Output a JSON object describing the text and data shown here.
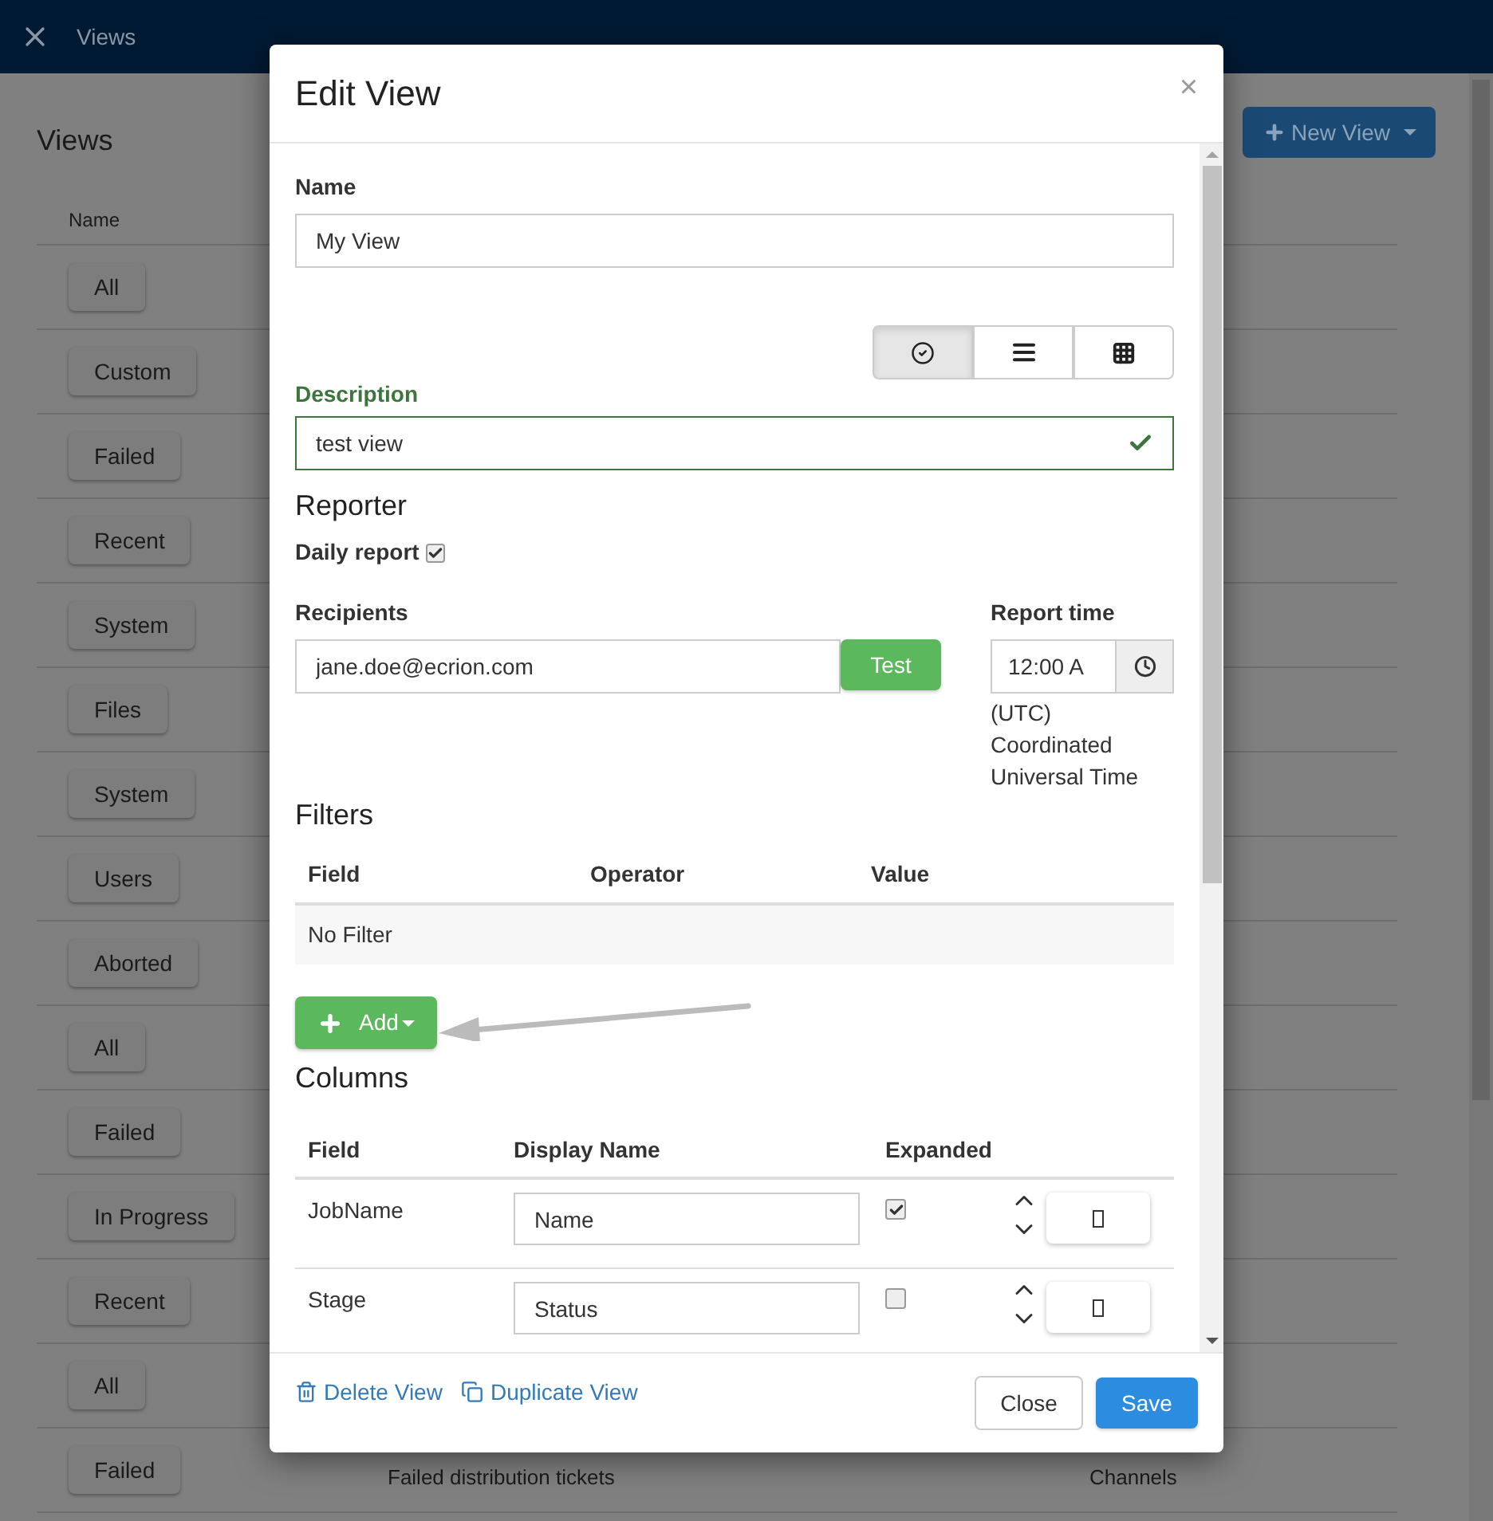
{
  "app_bar": {
    "title": "Views"
  },
  "page": {
    "title": "Views",
    "new_view_button": "New View",
    "name_column": "Name",
    "rows": [
      {
        "name": "All"
      },
      {
        "name": "Custom"
      },
      {
        "name": "Failed"
      },
      {
        "name": "Recent"
      },
      {
        "name": "System"
      },
      {
        "name": "Files"
      },
      {
        "name": "System"
      },
      {
        "name": "Users"
      },
      {
        "name": "Aborted"
      },
      {
        "name": "All"
      },
      {
        "name": "Failed"
      },
      {
        "name": "In Progress"
      },
      {
        "name": "Recent"
      },
      {
        "name": "All"
      },
      {
        "name": "Failed",
        "description": "Failed distribution tickets",
        "column_3": "Channels"
      }
    ]
  },
  "dialog": {
    "title": "Edit View",
    "close_symbol": "×",
    "name": {
      "label": "Name",
      "value": "My View"
    },
    "view_modes": [
      {
        "kind": "check",
        "selected": true
      },
      {
        "kind": "list",
        "selected": false
      },
      {
        "kind": "grid",
        "selected": false
      }
    ],
    "description": {
      "label": "Description",
      "value": "test view",
      "valid": true
    },
    "reporter": {
      "heading": "Reporter",
      "daily_report": {
        "label": "Daily report",
        "checked": true
      },
      "recipients": {
        "label": "Recipients",
        "value": "jane.doe@ecrion.com",
        "test_button": "Test"
      },
      "report_time": {
        "label": "Report time",
        "value": "12:00 A",
        "timezone": "(UTC) Coordinated Universal Time"
      }
    },
    "filters": {
      "heading": "Filters",
      "columns": [
        "Field",
        "Operator",
        "Value"
      ],
      "empty_text": "No Filter",
      "add_button": "Add"
    },
    "columns": {
      "heading": "Columns",
      "headers": [
        "Field",
        "Display Name",
        "Expanded"
      ],
      "rows": [
        {
          "field": "JobName",
          "display_name": "Name",
          "expanded": true
        },
        {
          "field": "Stage",
          "display_name": "Status",
          "expanded": false
        }
      ]
    },
    "footer": {
      "delete": "Delete View",
      "duplicate": "Duplicate View",
      "close": "Close",
      "save": "Save"
    }
  }
}
